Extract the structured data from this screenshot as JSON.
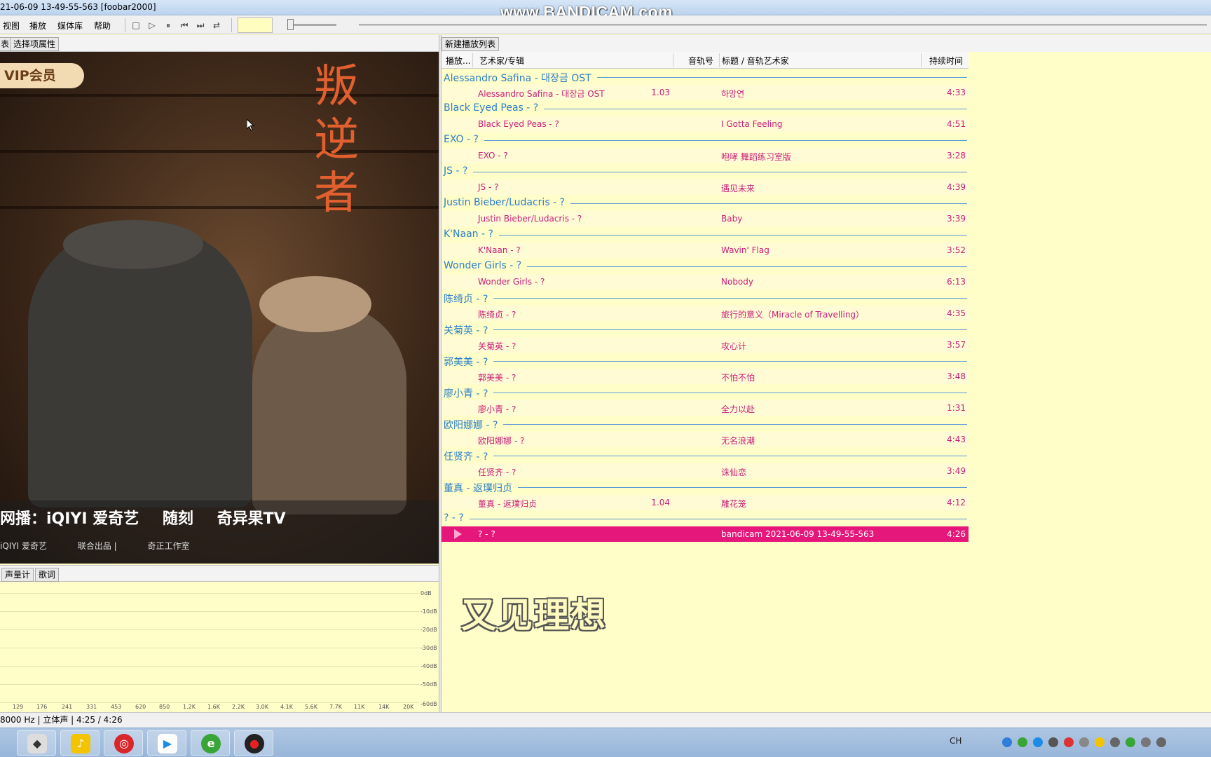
{
  "window": {
    "title": "21-06-09 13-49-55-563  [foobar2000]",
    "watermark": "www.BANDICAM.com"
  },
  "menu": [
    "视图",
    "播放",
    "媒体库",
    "帮助"
  ],
  "left_tabs": [
    "表",
    "选择项属性"
  ],
  "album_art": {
    "badge": "VIP会员",
    "title": "叛逆者",
    "logos": [
      "网播：iQIYI 爱奇艺",
      "随刻",
      "奇异果TV"
    ],
    "credits": [
      "iQIYI 爱奇艺",
      "联合出品 |",
      "奇正工作室"
    ]
  },
  "vis_tabs": [
    "声量计",
    "歌词"
  ],
  "spectrum": {
    "db_labels": [
      "0dB",
      "-10dB",
      "-20dB",
      "-30dB",
      "-40dB",
      "-50dB",
      "-60dB"
    ],
    "freq_labels": [
      "129",
      "176",
      "241",
      "331",
      "453",
      "620",
      "850",
      "1.2K",
      "1.6K",
      "2.2K",
      "3.0K",
      "4.1K",
      "5.6K",
      "7.7K",
      "11K",
      "14K",
      "20K"
    ]
  },
  "playlist": {
    "tab": "新建播放列表",
    "columns": [
      "播放...",
      "艺术家/专辑",
      "音轨号",
      "标题 / 音轨艺术家",
      "持续时间"
    ],
    "groups": [
      {
        "name": "Alessandro Safina - 대장금 OST",
        "track": {
          "artist": "Alessandro Safina - 대장금 OST",
          "num": "1.03",
          "title": "하망연",
          "dur": "4:33"
        }
      },
      {
        "name": "Black Eyed Peas - ?",
        "track": {
          "artist": "Black Eyed Peas - ?",
          "num": "",
          "title": "I Gotta Feeling",
          "dur": "4:51"
        }
      },
      {
        "name": "EXO - ?",
        "track": {
          "artist": "EXO - ?",
          "num": "",
          "title": "咆哮 舞蹈练习室版",
          "dur": "3:28"
        }
      },
      {
        "name": "JS - ?",
        "track": {
          "artist": "JS - ?",
          "num": "",
          "title": "遇见未来",
          "dur": "4:39"
        }
      },
      {
        "name": "Justin Bieber/Ludacris - ?",
        "track": {
          "artist": "Justin Bieber/Ludacris - ?",
          "num": "",
          "title": "Baby",
          "dur": "3:39"
        }
      },
      {
        "name": "K'Naan - ?",
        "track": {
          "artist": "K'Naan - ?",
          "num": "",
          "title": "Wavin' Flag",
          "dur": "3:52"
        }
      },
      {
        "name": "Wonder Girls - ?",
        "track": {
          "artist": "Wonder Girls - ?",
          "num": "",
          "title": "Nobody",
          "dur": "6:13"
        }
      },
      {
        "name": "陈绮贞 - ?",
        "track": {
          "artist": "陈绮贞 - ?",
          "num": "",
          "title": "旅行的意义（Miracle of Travelling）",
          "dur": "4:35"
        }
      },
      {
        "name": "关菊英 - ?",
        "track": {
          "artist": "关菊英 - ?",
          "num": "",
          "title": "攻心计",
          "dur": "3:57"
        }
      },
      {
        "name": "郭美美 - ?",
        "track": {
          "artist": "郭美美 - ?",
          "num": "",
          "title": "不怕不怕",
          "dur": "3:48"
        }
      },
      {
        "name": "廖小青 - ?",
        "track": {
          "artist": "廖小青 - ?",
          "num": "",
          "title": "全力以赴",
          "dur": "1:31"
        }
      },
      {
        "name": "欧阳娜娜 - ?",
        "track": {
          "artist": "欧阳娜娜 - ?",
          "num": "",
          "title": "无名浪潮",
          "dur": "4:43"
        }
      },
      {
        "name": "任贤齐 - ?",
        "track": {
          "artist": "任贤齐 - ?",
          "num": "",
          "title": "诛仙恋",
          "dur": "3:49"
        }
      },
      {
        "name": "董真 - 返璞归贞",
        "track": {
          "artist": "董真 - 返璞归贞",
          "num": "1.04",
          "title": "雕花笼",
          "dur": "4:12"
        }
      },
      {
        "name": "? - ?",
        "track": {
          "artist": "? - ?",
          "num": "",
          "title": "bandicam 2021-06-09 13-49-55-563",
          "dur": "4:26",
          "playing": true
        }
      }
    ]
  },
  "lyric": "又见理想",
  "status": "8000 Hz | 立体声 | 4:25 / 4:26",
  "tray": {
    "lang": "CH"
  },
  "colors": {
    "group": "#2b7fc9",
    "track": "#c8207a",
    "playing_bg": "#e5177a",
    "panel_bg": "#fffdc8"
  }
}
